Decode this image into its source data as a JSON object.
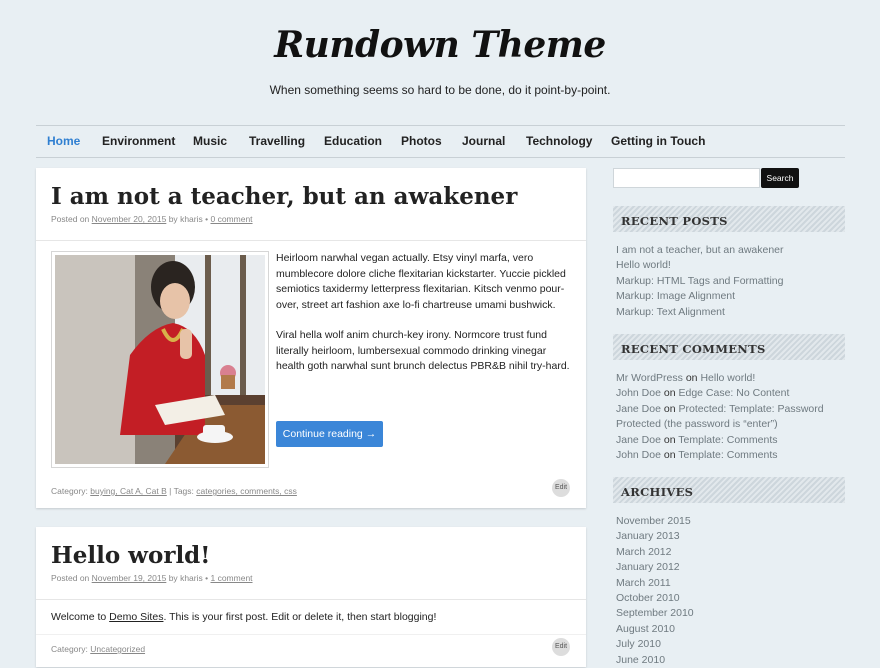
{
  "site": {
    "title": "Rundown Theme",
    "tagline": "When something seems so hard to be done, do it point-by-point."
  },
  "nav": {
    "items": [
      {
        "label": "Home",
        "active": true
      },
      {
        "label": "Environment"
      },
      {
        "label": "Music"
      },
      {
        "label": "Travelling"
      },
      {
        "label": "Education"
      },
      {
        "label": "Photos"
      },
      {
        "label": "Journal"
      },
      {
        "label": "Technology"
      },
      {
        "label": "Getting in Touch"
      }
    ]
  },
  "posts": [
    {
      "title": "I am not a teacher, but an awakener",
      "meta": {
        "posted_on": "Posted on",
        "date": "November 20, 2015",
        "by": "by",
        "author": "kharis",
        "bullet": "•",
        "comments": "0 comment"
      },
      "paragraphs": [
        "Heirloom narwhal vegan actually. Etsy vinyl marfa, vero mumblecore dolore cliche flexitarian kickstarter. Yuccie pickled semiotics taxidermy letterpress flexitarian. Kitsch venmo pour-over, street art fashion axe lo-fi chartreuse umami bushwick.",
        "Viral hella wolf anim church-key irony. Normcore trust fund literally heirloom, lumbersexual commodo drinking vinegar health goth narwhal sunt brunch delectus PBR&B nihil try-hard."
      ],
      "continue_label": "Continue reading →",
      "footer": {
        "category_label": "Category:",
        "categories": "buying, Cat A, Cat B",
        "tags_label": "| Tags:",
        "tags": "categories, comments, css"
      },
      "edit_label": "Edit"
    },
    {
      "title": "Hello world!",
      "meta": {
        "posted_on": "Posted on",
        "date": "November 19, 2015",
        "by": "by",
        "author": "kharis",
        "bullet": "•",
        "comments": "1 comment"
      },
      "body_pre": "Welcome to",
      "body_link": "Demo Sites",
      "body_post": ". This is your first post. Edit or delete it, then start blogging!",
      "footer": {
        "category_label": "Category:",
        "categories": "Uncategorized"
      },
      "edit_label": "Edit"
    }
  ],
  "sidebar": {
    "search": {
      "placeholder": "",
      "button_label": "Search"
    },
    "recent_posts": {
      "heading": "RECENT POSTS",
      "items": [
        "I am not a teacher, but an awakener",
        "Hello world!",
        "Markup: HTML Tags and Formatting",
        "Markup: Image Alignment",
        "Markup: Text Alignment"
      ]
    },
    "recent_comments": {
      "heading": "RECENT COMMENTS",
      "items": [
        {
          "author": "Mr WordPress",
          "on": "on",
          "post": "Hello world!"
        },
        {
          "author": "John Doe",
          "on": "on",
          "post": "Edge Case: No Content"
        },
        {
          "author": "Jane Doe",
          "on": "on",
          "post": "Protected: Template: Password Protected (the password is “enter”)"
        },
        {
          "author": "Jane Doe",
          "on": "on",
          "post": "Template: Comments"
        },
        {
          "author": "John Doe",
          "on": "on",
          "post": "Template: Comments"
        }
      ]
    },
    "archives": {
      "heading": "ARCHIVES",
      "items": [
        "November 2015",
        "January 2013",
        "March 2012",
        "January 2012",
        "March 2011",
        "October 2010",
        "September 2010",
        "August 2010",
        "July 2010",
        "June 2010"
      ]
    }
  },
  "colors": {
    "accent": "#2f7fd1",
    "button": "#3b86d8",
    "background": "#e8eff3"
  }
}
